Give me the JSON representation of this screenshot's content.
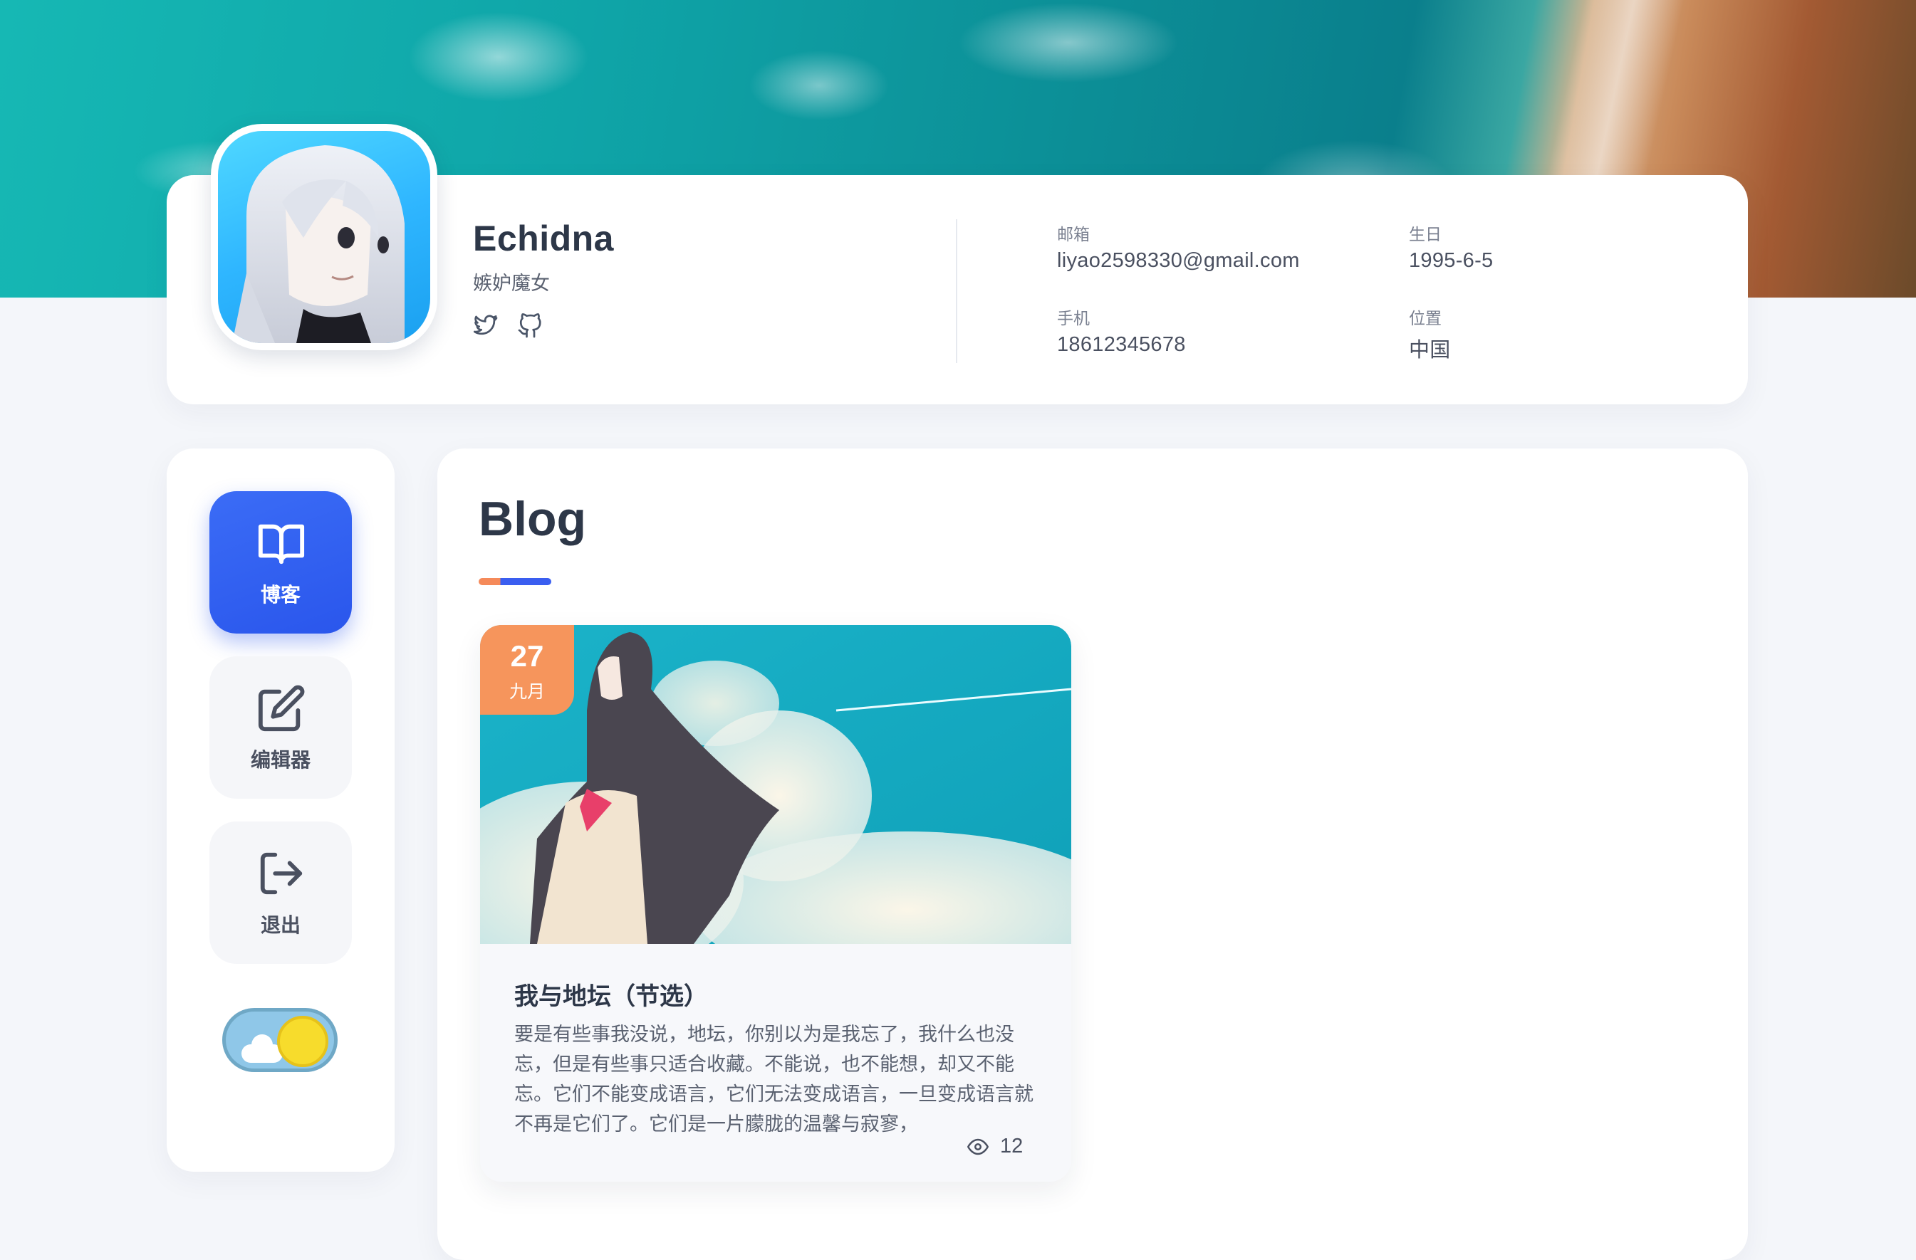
{
  "profile": {
    "name": "Echidna",
    "subtitle": "嫉妒魔女",
    "social": [
      {
        "icon": "twitter-icon"
      },
      {
        "icon": "github-icon"
      }
    ],
    "info": {
      "email_label": "邮箱",
      "email_value": "liyao2598330@gmail.com",
      "birthday_label": "生日",
      "birthday_value": "1995-6-5",
      "phone_label": "手机",
      "phone_value": "18612345678",
      "location_label": "位置",
      "location_value": "中国"
    }
  },
  "nav": {
    "items": [
      {
        "label": "博客",
        "icon": "book-open-icon",
        "active": true
      },
      {
        "label": "编辑器",
        "icon": "edit-icon",
        "active": false
      },
      {
        "label": "退出",
        "icon": "logout-icon",
        "active": false
      }
    ],
    "theme_toggle": {
      "state": "light",
      "icon": "sun-icon"
    }
  },
  "main": {
    "section_title": "Blog",
    "posts": [
      {
        "date_day": "27",
        "date_month": "九月",
        "title": "我与地坛（节选）",
        "excerpt": "要是有些事我没说，地坛，你别以为是我忘了，我什么也没忘，但是有些事只适合收藏。不能说，也不能想，却又不能忘。它们不能变成语言，它们无法变成语言，一旦变成语言就不再是它们了。它们是一片朦胧的温馨与寂寥，",
        "views": "12"
      }
    ]
  },
  "colors": {
    "accent_blue": "#2a56ec",
    "accent_orange": "#f6955c",
    "text_dark": "#2d3748",
    "background": "#f4f6fa"
  }
}
